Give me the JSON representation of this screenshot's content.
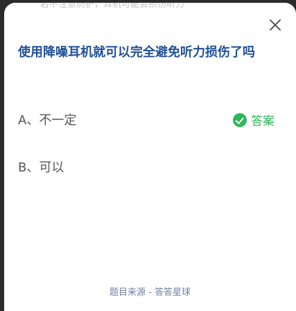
{
  "top_strip_text": "若不注意防护，耳机可能会损伤听力",
  "question": "使用降噪耳机就可以完全避免听力损伤了吗",
  "options": [
    {
      "label": "A、不一定"
    },
    {
      "label": "B、可以"
    }
  ],
  "answer_label": "答案",
  "source": "题目来源 - 答答星球",
  "colors": {
    "question": "#1f4f98",
    "answer": "#2fb85a",
    "option": "#555555",
    "source": "#6e7fa6"
  }
}
